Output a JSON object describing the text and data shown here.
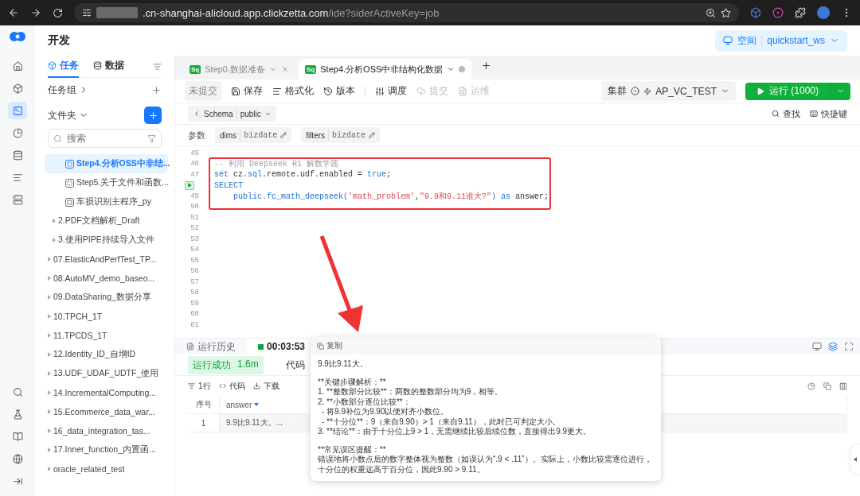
{
  "browser": {
    "url_host": ".cn-shanghai-alicloud.app.clickzetta.com",
    "url_path": "/ide?siderActiveKey=job"
  },
  "rail": {
    "top": [
      {
        "kind": "home",
        "selected": false
      },
      {
        "kind": "cube",
        "selected": false
      },
      {
        "kind": "terminal",
        "selected": true
      },
      {
        "kind": "chart",
        "selected": false
      },
      {
        "kind": "database",
        "selected": false
      },
      {
        "kind": "list",
        "selected": false
      },
      {
        "kind": "server",
        "selected": false
      }
    ],
    "bottom": [
      {
        "kind": "search"
      },
      {
        "kind": "flask"
      },
      {
        "kind": "book"
      },
      {
        "kind": "globe"
      },
      {
        "kind": "collapse"
      }
    ]
  },
  "header": {
    "title": "开发",
    "workspace_label": "空间",
    "workspace": "quickstart_ws"
  },
  "left_panel": {
    "tabs": [
      {
        "label": "任务",
        "selected": true
      },
      {
        "label": "数据",
        "selected": false
      }
    ],
    "task_group": "任务组",
    "folder": "文件夹",
    "search": {
      "placeholder": "搜索"
    },
    "tree": [
      {
        "children": [
          {
            "children": [
              {
                "label": "Step4.分析OSS中非结...",
                "kind": "sql",
                "selected": true
              },
              {
                "label": "Step5.关于文件和函数...",
                "kind": "sql",
                "selected": false
              },
              {
                "label": "车损识别主程序_py",
                "kind": "python",
                "selected": false
              }
            ]
          },
          {
            "label": "2.PDF文档解析_Draft",
            "kind": "folder",
            "selected": false
          },
          {
            "label": "3.使用PIPE持续导入文件",
            "kind": "folder",
            "selected": false
          }
        ]
      },
      {
        "label": "07.ElasticAndPerfTest_TP...",
        "kind": "folder",
        "selected": false
      },
      {
        "label": "08.AutoMV_demo_baseo...",
        "kind": "folder",
        "selected": false
      },
      {
        "label": "09.DataSharing_数据分享",
        "kind": "folder",
        "selected": false
      },
      {
        "label": "10.TPCH_1T",
        "kind": "folder",
        "selected": false
      },
      {
        "label": "11.TPCDS_1T",
        "kind": "folder",
        "selected": false
      },
      {
        "label": "12.Identity_ID_自增ID",
        "kind": "folder",
        "selected": false
      },
      {
        "label": "13.UDF_UDAF_UDTF_使用",
        "kind": "folder",
        "selected": false
      },
      {
        "label": "14.IncrementalComputing...",
        "kind": "folder",
        "selected": false
      },
      {
        "label": "15.Ecommerce_data_war...",
        "kind": "folder",
        "selected": false
      },
      {
        "label": "16_data_integration_tas...",
        "kind": "folder",
        "selected": false
      },
      {
        "label": "17.Inner_function_内置函...",
        "kind": "folder",
        "selected": false
      },
      {
        "label": "oracle_related_test",
        "kind": "folder",
        "selected": false
      }
    ]
  },
  "editor_tabs": [
    {
      "icon": "Sq",
      "label": "Step0.数据准备",
      "selected": false
    },
    {
      "icon": "Sq",
      "label": "Step4.分析OSS中非结构化数据",
      "selected": true
    }
  ],
  "toolbar": {
    "status": "未提交",
    "items": [
      {
        "kind": "save",
        "label": "保存",
        "disabled": false
      },
      {
        "kind": "format",
        "label": "格式化",
        "disabled": false
      },
      {
        "kind": "version",
        "label": "版本",
        "disabled": false
      },
      {
        "kind": "schedule",
        "label": "调度",
        "disabled": false
      },
      {
        "kind": "submit",
        "label": "提交",
        "disabled": true
      },
      {
        "kind": "ops",
        "label": "运维",
        "disabled": true
      }
    ],
    "cluster_label": "集群",
    "cluster": "AP_VC_TEST",
    "run": "运行 (1000)"
  },
  "schema": {
    "label": "Schema",
    "value": "public",
    "find": "查找",
    "shortcuts": "快捷键"
  },
  "params": {
    "label": "参数",
    "chips": [
      {
        "name": "dims",
        "value": "bizdate"
      },
      {
        "name": "filters",
        "value": "bizdate"
      }
    ]
  },
  "code": [
    {
      "number": "45",
      "run_marker": false
    },
    {
      "number": "46",
      "run_marker": false,
      "tokens": [
        {
          "t": "-- 利用 Deepseek R1 解数学题",
          "kind": "comment"
        }
      ]
    },
    {
      "number": "47",
      "run_marker": false,
      "tokens": [
        {
          "t": "set",
          "kind": "keyword"
        },
        {
          "t": " cz.",
          "kind": "plain"
        },
        {
          "t": "sql",
          "kind": "keyword"
        },
        {
          "t": ".remote.udf.enabled = ",
          "kind": "plain"
        },
        {
          "t": "true",
          "kind": "keyword"
        },
        {
          "t": ";",
          "kind": "plain"
        }
      ]
    },
    {
      "run_marker": true,
      "tokens": [
        {
          "t": "SELECT",
          "kind": "keyword"
        }
      ]
    },
    {
      "number": "49",
      "run_marker": false,
      "tokens": [
        {
          "t": "    public.fc_math_deepseek(",
          "kind": "keyword"
        },
        {
          "t": "'math_problem'",
          "kind": "string"
        },
        {
          "t": ",",
          "kind": "plain"
        },
        {
          "t": "\"9.9和9.11谁大?\"",
          "kind": "string"
        },
        {
          "t": ") as",
          "kind": "keyword"
        },
        {
          "t": " answer;",
          "kind": "plain"
        }
      ]
    },
    {
      "number": "50",
      "run_marker": false
    },
    {
      "number": "51",
      "run_marker": false
    },
    {
      "number": "52",
      "run_marker": false
    },
    {
      "number": "53",
      "run_marker": false
    },
    {
      "number": "54",
      "run_marker": false
    },
    {
      "number": "55",
      "run_marker": false
    },
    {
      "number": "56",
      "run_marker": false
    },
    {
      "number": "57",
      "run_marker": false
    },
    {
      "number": "58",
      "run_marker": false
    },
    {
      "number": "59",
      "run_marker": false
    },
    {
      "number": "60",
      "run_marker": false
    },
    {
      "number": "61",
      "run_marker": false
    }
  ],
  "bottom_panel": {
    "tabs": [
      {
        "kind": "history",
        "label": "运行历史",
        "selected": false
      },
      {
        "kind": "run",
        "label": "00:03:53",
        "selected": true
      }
    ],
    "layouts": [
      {
        "kind": "full",
        "selected": false
      },
      {
        "kind": "split",
        "selected": true
      },
      {
        "kind": "max",
        "selected": false
      }
    ],
    "status": "运行成功",
    "duration": "1.6m",
    "result_tabs": [
      {
        "label": "代码"
      }
    ],
    "result_toolbar": [
      {
        "kind": "rows",
        "label": "1行"
      },
      {
        "kind": "code",
        "label": "代码"
      },
      {
        "kind": "download",
        "label": "下载"
      }
    ],
    "table": {
      "columns": [
        "序号",
        "answer"
      ],
      "rows": [
        [
          "1",
          "9.9比9.11大。..."
        ]
      ]
    }
  },
  "popup": {
    "copy": "复制",
    "sections": [
      {
        "lines": [
          {
            "text": "9.9比9.11大。",
            "kind": "text"
          }
        ]
      },
      {
        "lines": [
          {
            "text": "**关键步骤解析：**",
            "kind": "text"
          },
          {
            "text": "1. **整数部分比较**：两数的整数部分均为9，相等。",
            "kind": "text"
          },
          {
            "text": "2. **小数部分逐位比较**：",
            "kind": "text"
          },
          {
            "text": "- 将9.9补位为9.90以便对齐小数位。",
            "kind": "sub"
          },
          {
            "text": "- **十分位**：9（来自9.90）> 1（来自9.11），此时已可判定大小。",
            "kind": "sub"
          },
          {
            "text": "3. **结论**：由于十分位上9 > 1，无需继续比较后续位数，直接得出9.9更大。",
            "kind": "text"
          }
        ]
      },
      {
        "lines": [
          {
            "text": "**常见误区提醒：**",
            "kind": "text"
          },
          {
            "text": "错误地将小数点后的数字整体视为整数（如误认为“.9 < .11”）。实际上，小数比较需逐位进行，十分位的权重远高于百分位，因此9.90 > 9.11。",
            "kind": "text"
          }
        ]
      }
    ]
  }
}
